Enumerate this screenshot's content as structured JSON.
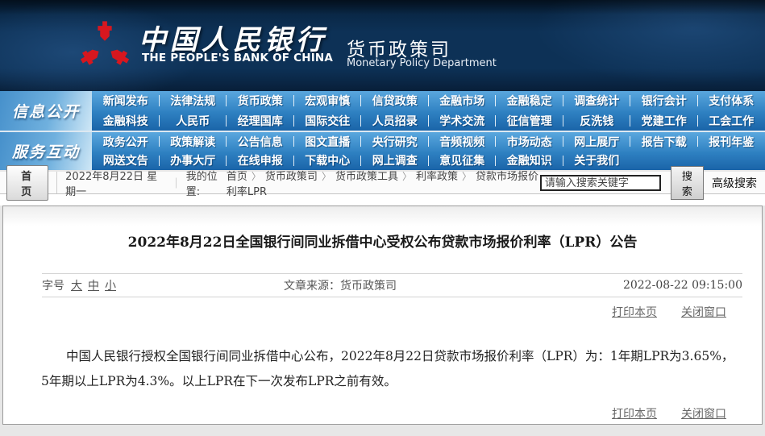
{
  "header": {
    "bank_name_zh": "中国人民银行",
    "bank_name_en": "THE PEOPLE'S BANK OF CHINA",
    "dept_zh": "货币政策司",
    "dept_en": "Monetary Policy Department"
  },
  "nav": {
    "sections": [
      {
        "label": "信息公开",
        "rows": [
          [
            "新闻发布",
            "法律法规",
            "货币政策",
            "宏观审慎",
            "信贷政策",
            "金融市场",
            "金融稳定",
            "调查统计",
            "银行会计",
            "支付体系"
          ],
          [
            "金融科技",
            "人民币",
            "经理国库",
            "国际交往",
            "人员招录",
            "学术交流",
            "征信管理",
            "反洗钱",
            "党建工作",
            "工会工作"
          ]
        ]
      },
      {
        "label": "服务互动",
        "rows": [
          [
            "政务公开",
            "政策解读",
            "公告信息",
            "图文直播",
            "央行研究",
            "音频视频",
            "市场动态",
            "网上展厅",
            "报告下载",
            "报刊年鉴"
          ],
          [
            "网送文告",
            "办事大厅",
            "在线申报",
            "下载中心",
            "网上调查",
            "意见征集",
            "金融知识",
            "关于我们"
          ]
        ]
      }
    ]
  },
  "crumbbar": {
    "home_button": "首 页",
    "date": "2022年8月22日 星期一",
    "separator": "｜",
    "location_label": "我的位置:",
    "crumbs": [
      "首页",
      "货币政策司",
      "货币政策工具",
      "利率政策",
      "贷款市场报价利率LPR"
    ],
    "search": {
      "placeholder": "请输入搜索关键字",
      "button": "搜索",
      "advanced": "高级搜索"
    }
  },
  "article": {
    "title": "2022年8月22日全国银行间同业拆借中心受权公布贷款市场报价利率（LPR）公告",
    "font_size_label": "字号",
    "font_sizes": [
      "大",
      "中",
      "小"
    ],
    "source_label": "文章来源：",
    "source": "货币政策司",
    "timestamp": "2022-08-22 09:15:00",
    "print_link": "打印本页",
    "close_link": "关闭窗口",
    "body": "中国人民银行授权全国银行间同业拆借中心公布，2022年8月22日贷款市场报价利率（LPR）为：1年期LPR为3.65%，5年期以上LPR为4.3%。以上LPR在下一次发布LPR之前有效。"
  },
  "colors": {
    "brand_red": "#d7171f",
    "header_navy": "#0d3156",
    "nav_blue": "#2e80c1",
    "nav_blue_dark": "#1a64a8",
    "nav_label_light": "#cfe7f6",
    "link_gray": "#666666",
    "card_border": "#9b9b9b"
  }
}
